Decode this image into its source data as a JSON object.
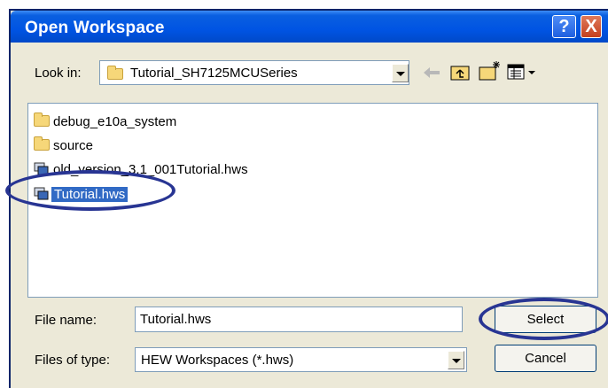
{
  "title": "Open Workspace",
  "titlebar": {
    "help_label": "?",
    "close_label": "X"
  },
  "look_in": {
    "label": "Look in:",
    "value": "Tutorial_SH7125MCUSeries"
  },
  "toolbar": [
    "back-icon",
    "up-folder-icon",
    "new-folder-icon",
    "view-menu-icon"
  ],
  "files": [
    {
      "name": "debug_e10a_system",
      "type": "folder"
    },
    {
      "name": "source",
      "type": "folder"
    },
    {
      "name": "old_version_3.1_001Tutorial.hws",
      "type": "workspace"
    },
    {
      "name": "Tutorial.hws",
      "type": "workspace",
      "selected": true
    }
  ],
  "file_name": {
    "label": "File name:",
    "value": "Tutorial.hws"
  },
  "file_type": {
    "label": "Files of type:",
    "value": "HEW Workspaces (*.hws)"
  },
  "buttons": {
    "select": "Select",
    "cancel": "Cancel"
  },
  "colors": {
    "selection": "#316ac5",
    "highlight_ellipse": "#283593",
    "titlebar": "#0054e3"
  }
}
